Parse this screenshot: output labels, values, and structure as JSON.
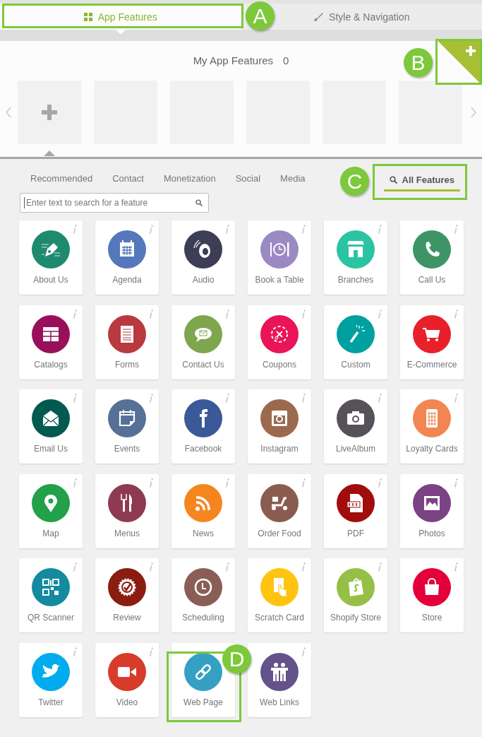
{
  "top_tabs": [
    {
      "label": "App Features",
      "selected": true
    },
    {
      "label": "Style & Navigation",
      "selected": false
    }
  ],
  "my_features": {
    "title": "My App Features",
    "count": "0",
    "slots": [
      {
        "kind": "add"
      },
      {
        "kind": "empty"
      },
      {
        "kind": "empty"
      },
      {
        "kind": "empty"
      },
      {
        "kind": "empty"
      },
      {
        "kind": "empty"
      }
    ]
  },
  "categories": [
    {
      "label": "Recommended",
      "kind": "category",
      "selected": false
    },
    {
      "label": "Contact",
      "kind": "category",
      "selected": false
    },
    {
      "label": "Monetization",
      "kind": "category",
      "selected": false
    },
    {
      "label": "Social",
      "kind": "category",
      "selected": false
    },
    {
      "label": "Media",
      "kind": "category",
      "selected": false
    },
    {
      "label": "All Features",
      "kind": "all",
      "selected": true
    }
  ],
  "search": {
    "placeholder": "Enter text to search for a feature"
  },
  "features": [
    {
      "label": "About Us",
      "color": "#1e8a6e",
      "info": true
    },
    {
      "label": "Agenda",
      "color": "#5577bb",
      "info": true
    },
    {
      "label": "Audio",
      "color": "#3d3d55",
      "info": true
    },
    {
      "label": "Book a Table",
      "color": "#9b89c4",
      "info": true
    },
    {
      "label": "Branches",
      "color": "#2bc4a2",
      "info": true
    },
    {
      "label": "Call Us",
      "color": "#3d9466",
      "info": true
    },
    {
      "label": "Catalogs",
      "color": "#99105a",
      "info": true
    },
    {
      "label": "Forms",
      "color": "#b8393e",
      "info": true
    },
    {
      "label": "Contact Us",
      "color": "#7ea64e",
      "info": true
    },
    {
      "label": "Coupons",
      "color": "#ea1459",
      "info": true
    },
    {
      "label": "Custom",
      "color": "#00a0a0",
      "info": true
    },
    {
      "label": "E-Commerce",
      "color": "#e8202a",
      "info": true
    },
    {
      "label": "Email Us",
      "color": "#005a50",
      "info": true
    },
    {
      "label": "Events",
      "color": "#577096",
      "info": true
    },
    {
      "label": "Facebook",
      "color": "#3b5998",
      "info": true
    },
    {
      "label": "Instagram",
      "color": "#9b6a4e",
      "info": true
    },
    {
      "label": "LiveAlbum",
      "color": "#57515a",
      "info": true
    },
    {
      "label": "Loyalty Cards",
      "color": "#f28652",
      "info": true
    },
    {
      "label": "Map",
      "color": "#22a04a",
      "info": true
    },
    {
      "label": "Menus",
      "color": "#8e3a52",
      "info": true
    },
    {
      "label": "News",
      "color": "#f5861f",
      "info": true
    },
    {
      "label": "Order Food",
      "color": "#8a5c50",
      "info": true
    },
    {
      "label": "PDF",
      "color": "#a10d0d",
      "info": true
    },
    {
      "label": "Photos",
      "color": "#7b4285",
      "info": true
    },
    {
      "label": "QR Scanner",
      "color": "#138aa0",
      "info": true
    },
    {
      "label": "Review",
      "color": "#8a1c10",
      "info": true
    },
    {
      "label": "Scheduling",
      "color": "#8a5e56",
      "info": true
    },
    {
      "label": "Scratch Card",
      "color": "#fec40f",
      "info": true
    },
    {
      "label": "Shopify Store",
      "color": "#95bf47",
      "info": true
    },
    {
      "label": "Store",
      "color": "#e4003a",
      "info": true
    },
    {
      "label": "Twitter",
      "color": "#00acee",
      "info": true
    },
    {
      "label": "Video",
      "color": "#d93b2b",
      "info": true
    },
    {
      "label": "Web Page",
      "color": "#35a0c4",
      "info": false
    },
    {
      "label": "Web Links",
      "color": "#64528a",
      "info": true
    }
  ],
  "callouts": [
    {
      "letter": "A"
    },
    {
      "letter": "B"
    },
    {
      "letter": "C"
    },
    {
      "letter": "D"
    }
  ]
}
